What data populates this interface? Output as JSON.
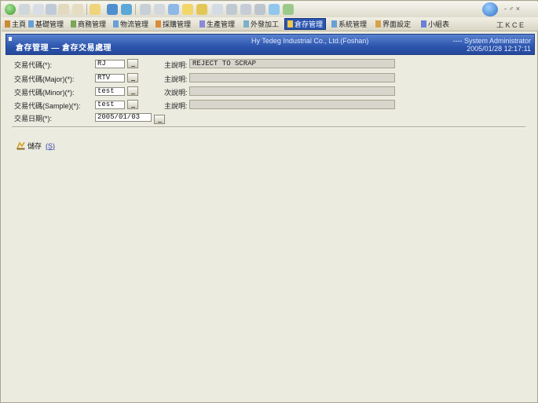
{
  "toolbar": {
    "buttons": [
      "back-icon",
      "forward-icon",
      "stop-icon",
      "refresh-icon",
      "home-icon",
      "search-icon",
      "favorites-icon",
      "history-icon",
      "mail-icon",
      "print-icon",
      "edit-icon",
      "discuss-icon",
      "messenger-icon"
    ],
    "help": "help-icon",
    "window_controls": "- ♂ ×"
  },
  "tabs": [
    {
      "label": "主頁",
      "active": false
    },
    {
      "label": "基礎管理",
      "active": false
    },
    {
      "label": "商務管理",
      "active": false
    },
    {
      "label": "物流管理",
      "active": false
    },
    {
      "label": "採購管理",
      "active": false
    },
    {
      "label": "生產管理",
      "active": false
    },
    {
      "label": "外發加工",
      "active": false
    },
    {
      "label": "倉存管理",
      "active": true
    },
    {
      "label": "系統管理",
      "active": false
    },
    {
      "label": "界面設定",
      "active": false
    },
    {
      "label": "小組表",
      "active": false
    }
  ],
  "tabs_more": "工 K C E",
  "header": {
    "title": "倉存管理 — 倉存交易處理",
    "company": "Hy Tedeg Industrial Co., Ltd.(Foshan)",
    "user_line1": "---- System Administrator",
    "user_line2": "2005/01/28 12:17:11"
  },
  "form": {
    "rows": [
      {
        "label": "交易代碼(*):",
        "value": "RJ",
        "desc_label": "主說明:",
        "desc_value": "REJECT TO SCRAP"
      },
      {
        "label": "交易代碼(Major)(*):",
        "value": "RTV",
        "desc_label": "主說明:",
        "desc_value": ""
      },
      {
        "label": "交易代碼(Minor)(*):",
        "value": "test",
        "desc_label": "次說明:",
        "desc_value": ""
      },
      {
        "label": "交易代碼(Sample)(*):",
        "value": "test",
        "desc_label": "主說明:",
        "desc_value": ""
      }
    ],
    "date_label": "交易日期(*):",
    "date_value": "2005/01/03"
  },
  "save": {
    "label": "儲存",
    "hotkey": "(S)"
  },
  "colors": {
    "header_bg": "#2c55ad",
    "active_tab": "#2a55b0",
    "page_bg": "#ecebe0"
  }
}
